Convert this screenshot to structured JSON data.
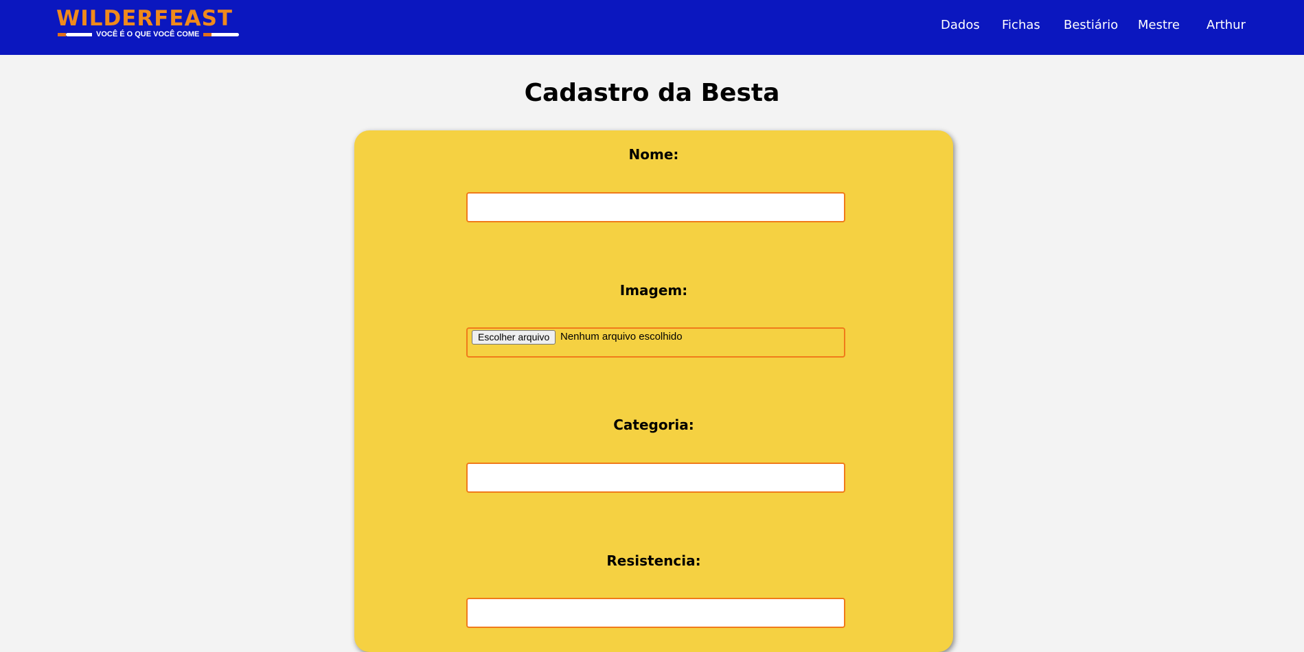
{
  "header": {
    "logo": {
      "title": "WILDERFEAST",
      "tagline": "VOCÊ É O QUE VOCÊ COME"
    },
    "nav": [
      {
        "label": "Dados"
      },
      {
        "label": "Fichas"
      },
      {
        "label": "Bestiário"
      },
      {
        "label": "Mestre"
      },
      {
        "label": "Arthur"
      }
    ],
    "colors": {
      "background": "#0b17bf",
      "logo_accent": "#f08a1c"
    }
  },
  "page": {
    "title": "Cadastro da Besta"
  },
  "form": {
    "background": "#f5d142",
    "input_border": "#f07a1a",
    "fields": {
      "nome": {
        "label": "Nome:",
        "value": ""
      },
      "imagem": {
        "label": "Imagem:",
        "button_label": "Escolher arquivo",
        "status": "Nenhum arquivo escolhido"
      },
      "categoria": {
        "label": "Categoria:",
        "value": ""
      },
      "resistencia": {
        "label": "Resistencia:",
        "value": ""
      }
    }
  }
}
